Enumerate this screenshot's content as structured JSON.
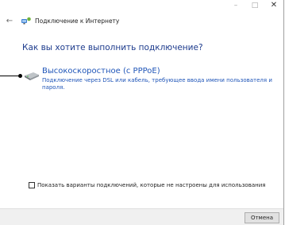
{
  "window": {
    "controls": {
      "minimize": "–",
      "maximize": "□",
      "close": "✕"
    }
  },
  "header": {
    "back_icon": "back-arrow-icon",
    "network_icon": "network-connection-icon",
    "title": "Подключение к Интернету"
  },
  "main": {
    "question": "Как вы хотите выполнить подключение?",
    "options": [
      {
        "icon": "broadband-modem-icon",
        "title": "Высокоскоростное (с PPPoE)",
        "description": "Подключение через DSL или кабель, требующее ввода имени пользователя и пароля."
      }
    ],
    "show_unconfigured": {
      "checked": false,
      "label": "Показать варианты подключений, которые не настроены для использования"
    }
  },
  "footer": {
    "cancel_label": "Отмена"
  },
  "colors": {
    "heading": "#1c3a8c",
    "link": "#1f55b8",
    "footer_bg": "#f0f0f0"
  }
}
